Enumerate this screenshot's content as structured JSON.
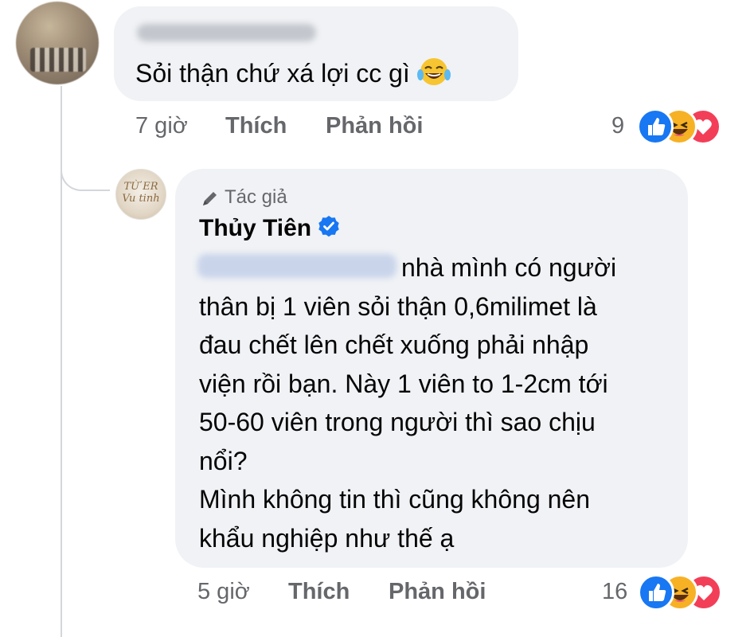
{
  "comment": {
    "text": "Sỏi thận chứ xá lợi cc gì",
    "time": "7 giờ",
    "like_label": "Thích",
    "reply_label": "Phản hồi",
    "reaction_count": "9",
    "reactions": [
      "like-icon",
      "haha-icon",
      "love-icon"
    ]
  },
  "reply": {
    "author_badge": "Tác giả",
    "author_name": "Thủy Tiên",
    "lines": [
      "nhà mình có người",
      "thân bị 1 viên sỏi thận 0,6milimet  là",
      "đau chết lên chết xuống phải nhập",
      "viện rồi bạn. Này 1 viên to 1-2cm tới",
      "50-60 viên trong người thì sao chịu",
      "nổi?",
      "Mình không tin thì cũng không nên",
      "khẩu nghiệp như thế ạ"
    ],
    "time": "5 giờ",
    "like_label": "Thích",
    "reply_label": "Phản hồi",
    "reaction_count": "16",
    "reactions": [
      "like-icon",
      "haha-icon",
      "love-icon"
    ]
  },
  "colors": {
    "bubble": "#f0f2f5",
    "meta_text": "#65676b",
    "like_blue": "#1877f2",
    "love_red": "#f33e58",
    "haha_yellow": "#f7b125"
  }
}
